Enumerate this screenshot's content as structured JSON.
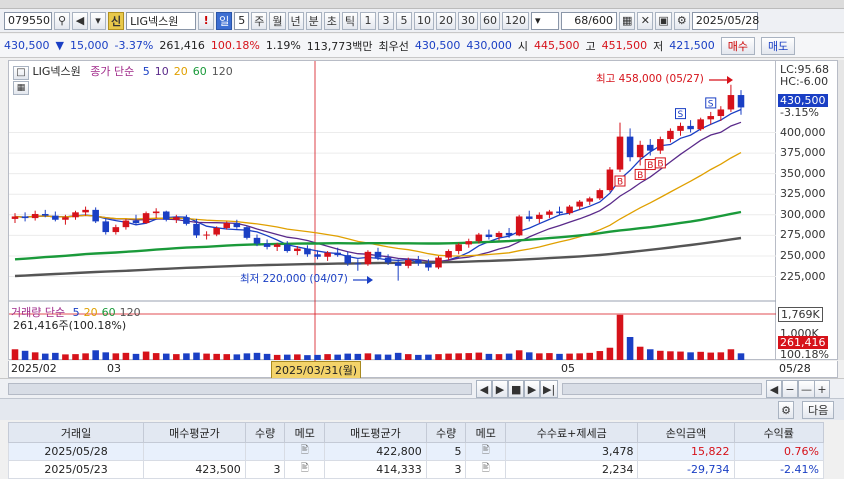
{
  "toolbar": {
    "stock_code": "079550",
    "badge": "신",
    "stock_name": "LIG넥스원",
    "period_day": "일",
    "period_count": "5",
    "period_week": "주",
    "period_month": "월",
    "period_year": "년",
    "period_minute": "분",
    "period_second": "초",
    "period_tick": "틱",
    "tick_options": [
      "1",
      "3",
      "5",
      "10",
      "20",
      "30",
      "60",
      "120"
    ],
    "count_display": "68",
    "count_total": "/600",
    "date_value": "2025/05/28"
  },
  "quote": {
    "price": "430,500",
    "change_arrow": "▼",
    "change": "15,000",
    "change_pct": "-3.37%",
    "volume": "261,416",
    "volume_ratio": "100.18%",
    "turnover": "1.19%",
    "amount": "113,773백만",
    "best_label": "최우선",
    "best_sell": "430,500",
    "best_buy": "430,000",
    "open_label": "시",
    "open": "445,500",
    "high_label": "고",
    "high": "451,500",
    "low_label": "저",
    "low": "421,500",
    "buy_btn": "매수",
    "sell_btn": "매도"
  },
  "chart_legend": {
    "name": "LIG넥스원",
    "ma_label": "종가 단순",
    "ma_periods": [
      "5",
      "10",
      "20",
      "60",
      "120"
    ],
    "ma_colors": [
      "#1a3fc4",
      "#5a2a8a",
      "#e0a000",
      "#1a9a3a",
      "#555555"
    ]
  },
  "annotations": {
    "high_note": "최고 458,000 (05/27)",
    "low_note": "최저 220,000 (04/07)"
  },
  "right_axis": {
    "lc": "LC:95.68",
    "hc": "HC:-6.00",
    "current_price": "430,500",
    "current_pct": "-3.15%",
    "ticks": [
      "400,000",
      "375,000",
      "350,000",
      "325,000",
      "300,000",
      "275,000",
      "250,000",
      "225,000"
    ],
    "vol_mark": "1,769K",
    "vol_1000k": "1,000K",
    "vol_current": "261,416",
    "vol_pct": "100.18%"
  },
  "volume_panel": {
    "legend": "거래량 단순",
    "periods": [
      "5",
      "20",
      "60",
      "120"
    ],
    "info": "261,416주(100.18%)"
  },
  "date_axis": {
    "labels": [
      "2025/02",
      "03",
      "05",
      "05/28"
    ],
    "crosshair_date": "2025/03/31(월)"
  },
  "grid_nav": {
    "next_btn": "다음"
  },
  "table": {
    "headers": [
      "거래일",
      "매수평균가",
      "수량",
      "메모",
      "매도평균가",
      "수량",
      "메모",
      "수수료+제세금",
      "손익금액",
      "수익률"
    ],
    "rows": [
      {
        "date": "2025/05/28",
        "buy_avg": "",
        "buy_qty": "",
        "sell_avg": "422,800",
        "sell_qty": "5",
        "fee": "3,478",
        "pnl": "15,822",
        "ret": "0.76%"
      },
      {
        "date": "2025/05/23",
        "buy_avg": "423,500",
        "buy_qty": "3",
        "sell_avg": "414,333",
        "sell_qty": "3",
        "fee": "2,234",
        "pnl": "-29,734",
        "ret": "-2.41%"
      }
    ]
  },
  "chart_data": {
    "type": "candlestick",
    "title": "LIG넥스원",
    "x_start": "2025/01/31",
    "x_end": "2025/05/28",
    "ylim": [
      205000,
      465000
    ],
    "ohlc": [
      [
        295000,
        302000,
        290000,
        298000
      ],
      [
        298000,
        303000,
        292000,
        296000
      ],
      [
        296000,
        305000,
        293000,
        301000
      ],
      [
        301000,
        306000,
        297000,
        299000
      ],
      [
        299000,
        304000,
        292000,
        294000
      ],
      [
        294000,
        300000,
        288000,
        297000
      ],
      [
        297000,
        305000,
        294000,
        303000
      ],
      [
        303000,
        310000,
        299000,
        306000
      ],
      [
        306000,
        309000,
        290000,
        292000
      ],
      [
        292000,
        296000,
        276000,
        279000
      ],
      [
        279000,
        288000,
        276000,
        285000
      ],
      [
        285000,
        295000,
        282000,
        293000
      ],
      [
        293000,
        300000,
        288000,
        290000
      ],
      [
        290000,
        304000,
        289000,
        302000
      ],
      [
        302000,
        308000,
        296000,
        304000
      ],
      [
        304000,
        305000,
        292000,
        294000
      ],
      [
        294000,
        300000,
        290000,
        297000
      ],
      [
        297000,
        300000,
        287000,
        289000
      ],
      [
        289000,
        295000,
        272000,
        275000
      ],
      [
        275000,
        280000,
        270000,
        276000
      ],
      [
        276000,
        286000,
        274000,
        284000
      ],
      [
        284000,
        292000,
        282000,
        290000
      ],
      [
        290000,
        294000,
        283000,
        285000
      ],
      [
        285000,
        287000,
        270000,
        272000
      ],
      [
        272000,
        276000,
        262000,
        265000
      ],
      [
        265000,
        270000,
        258000,
        261000
      ],
      [
        261000,
        266000,
        256000,
        264000
      ],
      [
        264000,
        268000,
        254000,
        256000
      ],
      [
        256000,
        262000,
        251000,
        259000
      ],
      [
        259000,
        263000,
        249000,
        252000
      ],
      [
        252000,
        257000,
        246000,
        249000
      ],
      [
        249000,
        256000,
        244000,
        254000
      ],
      [
        254000,
        260000,
        249000,
        251000
      ],
      [
        251000,
        255000,
        238000,
        241000
      ],
      [
        241000,
        246000,
        232000,
        240000
      ],
      [
        240000,
        257000,
        238000,
        255000
      ],
      [
        255000,
        260000,
        245000,
        248000
      ],
      [
        248000,
        252000,
        239000,
        242000
      ],
      [
        242000,
        246000,
        220000,
        238000
      ],
      [
        238000,
        248000,
        235000,
        245000
      ],
      [
        245000,
        250000,
        238000,
        241000
      ],
      [
        241000,
        246000,
        232000,
        236000
      ],
      [
        236000,
        250000,
        234000,
        248000
      ],
      [
        248000,
        258000,
        245000,
        256000
      ],
      [
        256000,
        266000,
        252000,
        264000
      ],
      [
        264000,
        271000,
        260000,
        268000
      ],
      [
        268000,
        278000,
        265000,
        276000
      ],
      [
        276000,
        282000,
        270000,
        273000
      ],
      [
        273000,
        280000,
        269000,
        278000
      ],
      [
        278000,
        284000,
        272000,
        275000
      ],
      [
        275000,
        300000,
        274000,
        298000
      ],
      [
        298000,
        305000,
        292000,
        295000
      ],
      [
        295000,
        303000,
        290000,
        300000
      ],
      [
        300000,
        306000,
        296000,
        304000
      ],
      [
        304000,
        310000,
        300000,
        302000
      ],
      [
        302000,
        312000,
        300000,
        310000
      ],
      [
        310000,
        318000,
        306000,
        316000
      ],
      [
        316000,
        322000,
        312000,
        320000
      ],
      [
        320000,
        332000,
        318000,
        330000
      ],
      [
        330000,
        358000,
        328000,
        355000
      ],
      [
        355000,
        412000,
        352000,
        395000
      ],
      [
        395000,
        405000,
        365000,
        370000
      ],
      [
        370000,
        390000,
        360000,
        385000
      ],
      [
        385000,
        392000,
        372000,
        378000
      ],
      [
        378000,
        395000,
        374000,
        392000
      ],
      [
        392000,
        405000,
        388000,
        402000
      ],
      [
        402000,
        412000,
        396000,
        408000
      ],
      [
        408000,
        415000,
        400000,
        404000
      ],
      [
        404000,
        418000,
        402000,
        416000
      ],
      [
        416000,
        425000,
        410000,
        420000
      ],
      [
        420000,
        432000,
        414000,
        428000
      ],
      [
        428000,
        458000,
        425000,
        445500
      ],
      [
        445500,
        451500,
        421500,
        430500
      ]
    ],
    "volume_ylim": [
      0,
      1800000
    ],
    "volume": [
      420000,
      360000,
      300000,
      250000,
      280000,
      220000,
      230000,
      260000,
      380000,
      300000,
      260000,
      280000,
      240000,
      330000,
      270000,
      250000,
      230000,
      260000,
      290000,
      250000,
      240000,
      230000,
      220000,
      260000,
      280000,
      240000,
      200000,
      210000,
      220000,
      190000,
      200000,
      230000,
      210000,
      250000,
      240000,
      260000,
      220000,
      210000,
      280000,
      230000,
      200000,
      210000,
      230000,
      250000,
      260000,
      270000,
      290000,
      240000,
      230000,
      250000,
      380000,
      300000,
      260000,
      270000,
      240000,
      250000,
      260000,
      280000,
      350000,
      480000,
      1769000,
      900000,
      520000,
      420000,
      360000,
      340000,
      330000,
      300000,
      320000,
      290000,
      300000,
      420000,
      261416
    ]
  }
}
